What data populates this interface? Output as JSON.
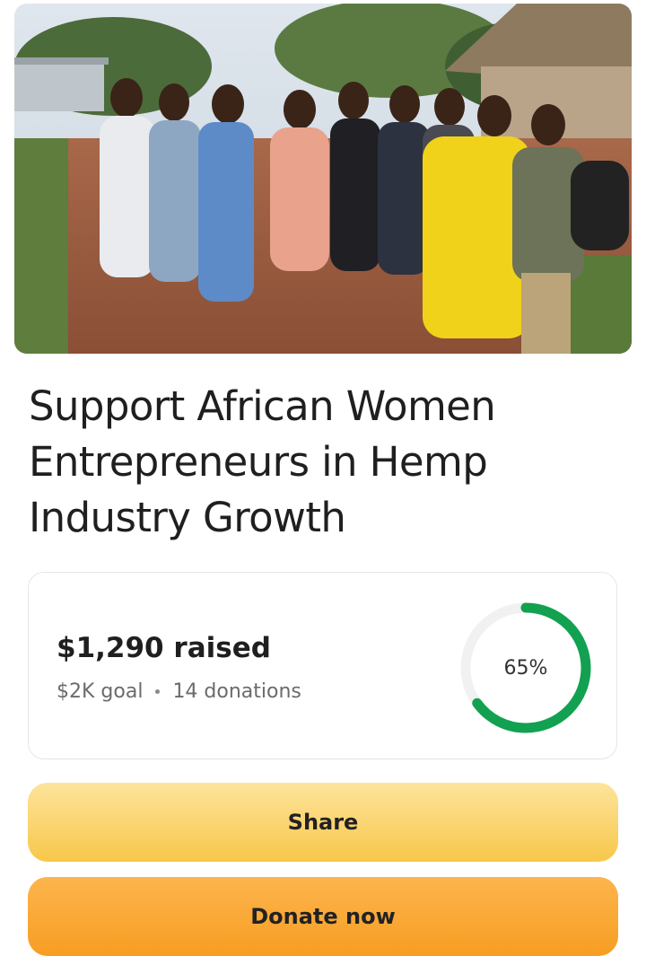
{
  "campaign": {
    "title": "Support African Women Entrepreneurs in Hemp Industry Growth",
    "hero_image_alt": "Group photo of campaign members"
  },
  "progress": {
    "raised": "$1,290 raised",
    "goal": "$2K goal",
    "donations": "14 donations",
    "percent_label": "65%",
    "fraction": 0.65,
    "color": "#12a150",
    "track_color": "#f1f1f1"
  },
  "actions": {
    "share_label": "Share",
    "donate_label": "Donate now"
  }
}
